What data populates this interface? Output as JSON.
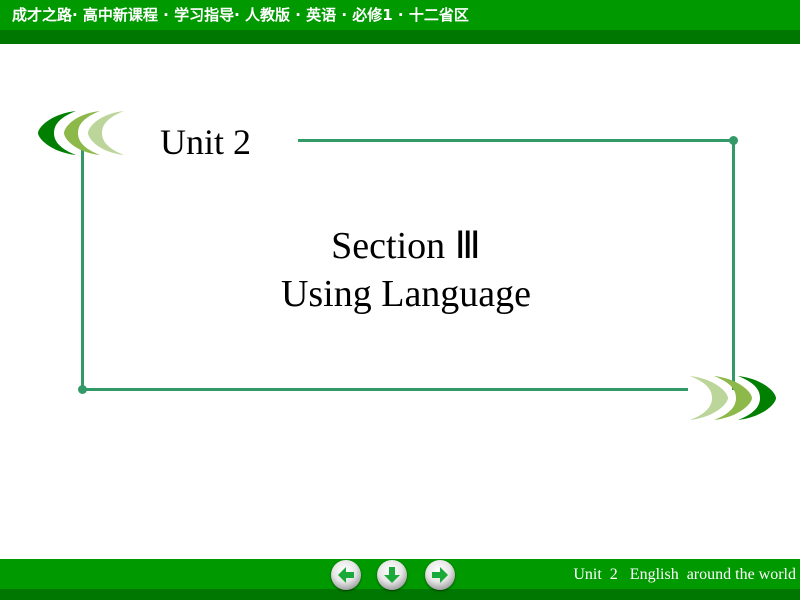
{
  "header": {
    "title": "成才之路· 高中新课程 · 学习指导· 人教版 · 英语 · 必修1 · 十二省区"
  },
  "slide": {
    "unit_title": "Unit 2",
    "section_title": "Section Ⅲ",
    "section_subtitle": "Using Language"
  },
  "footer": {
    "text": "Unit  2   English  around the world",
    "nav": [
      {
        "name": "previous",
        "icon": "arrow-left-icon"
      },
      {
        "name": "home",
        "icon": "arrow-down-icon"
      },
      {
        "name": "next",
        "icon": "arrow-right-icon"
      }
    ]
  },
  "colors": {
    "bar_green": "#009900",
    "bar_dark_green": "#007700",
    "frame_green": "#339966",
    "leaf_dark": "#007f00",
    "leaf_mid": "#8db84a",
    "leaf_light": "#bcd59a",
    "arrow_green": "#1aaa3a"
  }
}
